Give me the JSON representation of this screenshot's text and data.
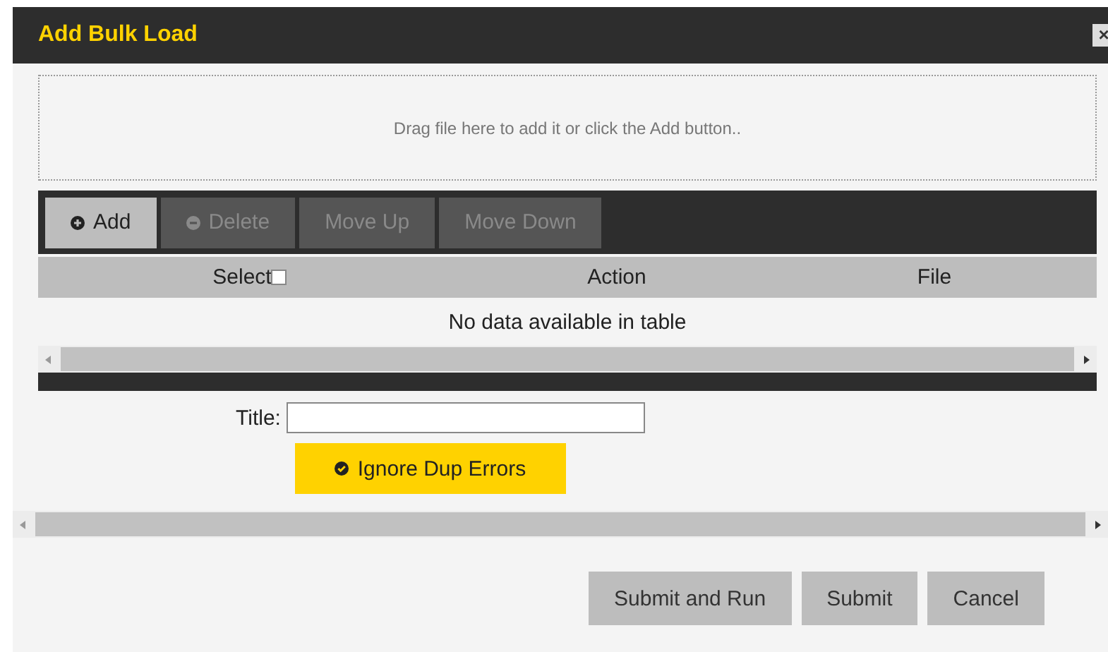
{
  "window": {
    "title": "Add Bulk Load",
    "close": "×"
  },
  "drop_zone": {
    "text": "Drag file here to add it or click the Add button.."
  },
  "toolbar": [
    {
      "label": "Add",
      "kind": "plus",
      "disabled": false
    },
    {
      "label": "Delete",
      "kind": "minus",
      "disabled": true
    },
    {
      "label": "Move Up",
      "kind": "plain",
      "disabled": true
    },
    {
      "label": "Move Down",
      "kind": "plain",
      "disabled": true
    }
  ],
  "table": {
    "columns": [
      {
        "label": "Select",
        "kind": "checkbox",
        "checked": false
      },
      {
        "label": "Action",
        "kind": "plain"
      },
      {
        "label": "File",
        "kind": "plain"
      }
    ],
    "empty_message": "No data available in table"
  },
  "title_field": {
    "label": "Title:"
  },
  "ignore_dup_errors": {
    "label": "Ignore Dup Errors",
    "on": true
  },
  "buttons": [
    "Submit and Run",
    "Submit",
    "Cancel"
  ]
}
